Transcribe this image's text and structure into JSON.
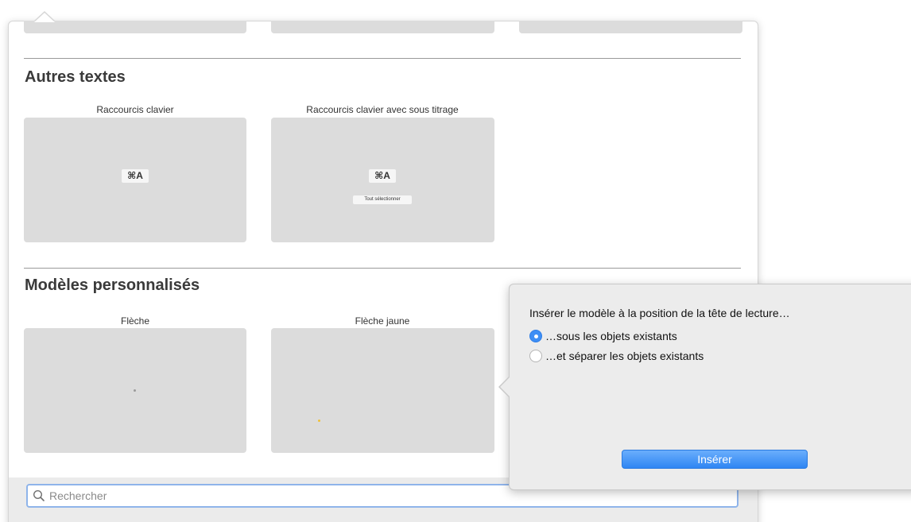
{
  "sections": {
    "autres_textes": {
      "title": "Autres textes",
      "items": [
        {
          "label": "Raccourcis clavier",
          "key": "⌘A"
        },
        {
          "label": "Raccourcis clavier avec sous titrage",
          "key": "⌘A",
          "caption": "Tout sélectionner"
        }
      ]
    },
    "modeles_personnalises": {
      "title": "Modèles personnalisés",
      "items": [
        {
          "label": "Flèche",
          "marker_color": "#9a9a9a"
        },
        {
          "label": "Flèche jaune",
          "marker_color": "#f0c23a"
        }
      ]
    }
  },
  "search": {
    "placeholder": "Rechercher",
    "value": ""
  },
  "insert_popover": {
    "title": "Insérer le modèle à la position de la tête de lecture…",
    "options": [
      {
        "label": "…sous les objets existants",
        "selected": true
      },
      {
        "label": "…et séparer les objets existants",
        "selected": false
      }
    ],
    "button_label": "Insérer"
  },
  "colors": {
    "accent": "#3d8ef5",
    "thumbnail_bg": "#dcdcdc",
    "search_focus": "#8fb4ea"
  }
}
